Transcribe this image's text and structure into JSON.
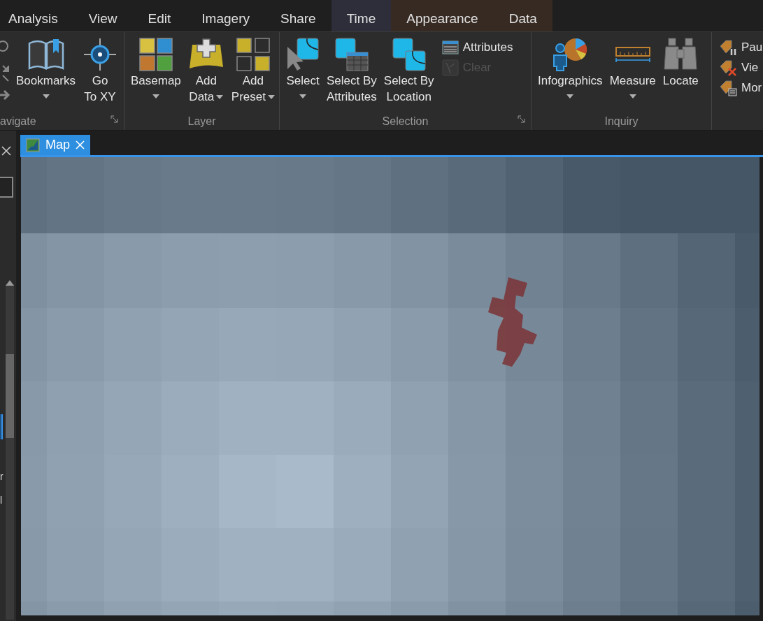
{
  "menu_tabs": [
    {
      "label": "Analysis",
      "selected": false
    },
    {
      "label": "View",
      "selected": false
    },
    {
      "label": "Edit",
      "selected": false
    },
    {
      "label": "Imagery",
      "selected": false
    },
    {
      "label": "Share",
      "selected": false
    },
    {
      "label": "Time",
      "selected": false,
      "color": "#2d2e3a"
    },
    {
      "label": "Appearance",
      "selected": false,
      "color": "#362a23"
    },
    {
      "label": "Data",
      "selected": false,
      "color": "#362a23"
    }
  ],
  "ribbon": {
    "groups": [
      {
        "label": "avigate",
        "launcher": true,
        "buttons": [
          {
            "kind": "large",
            "lines": [
              "Bookmarks"
            ],
            "dropdown": true,
            "disabled": false
          },
          {
            "kind": "large",
            "lines": [
              "Go",
              "To XY"
            ],
            "dropdown": false,
            "disabled": false
          }
        ]
      },
      {
        "label": "Layer",
        "buttons": [
          {
            "kind": "large",
            "lines": [
              "Basemap"
            ],
            "dropdown": true,
            "disabled": false
          },
          {
            "kind": "large",
            "lines": [
              "Add",
              "Data"
            ],
            "dropdown": true,
            "disabled": false
          },
          {
            "kind": "large",
            "lines": [
              "Add",
              "Preset"
            ],
            "dropdown": true,
            "disabled": false
          }
        ]
      },
      {
        "label": "Selection",
        "launcher": true,
        "buttons": [
          {
            "kind": "large",
            "lines": [
              "Select"
            ],
            "dropdown": true,
            "disabled": false
          },
          {
            "kind": "large",
            "lines": [
              "Select By",
              "Attributes"
            ],
            "dropdown": false,
            "disabled": false
          },
          {
            "kind": "large",
            "lines": [
              "Select By",
              "Location"
            ],
            "dropdown": false,
            "disabled": false
          },
          {
            "kind": "small",
            "lines": [
              "Attributes"
            ],
            "disabled": false
          },
          {
            "kind": "small",
            "lines": [
              "Clear"
            ],
            "disabled": true
          }
        ]
      },
      {
        "label": "Inquiry",
        "buttons": [
          {
            "kind": "large",
            "lines": [
              "Infographics"
            ],
            "dropdown": true,
            "disabled": false
          },
          {
            "kind": "large",
            "lines": [
              "Measure"
            ],
            "dropdown": true,
            "disabled": false
          },
          {
            "kind": "large",
            "lines": [
              "Locate"
            ],
            "dropdown": false,
            "disabled": false
          }
        ]
      },
      {
        "buttons": [
          {
            "kind": "small",
            "lines": [
              "Pau"
            ],
            "disabled": false
          },
          {
            "kind": "small",
            "lines": [
              "Vie"
            ],
            "disabled": false
          },
          {
            "kind": "small",
            "lines": [
              "Mor"
            ],
            "disabled": false
          }
        ]
      }
    ]
  },
  "side_panel": {
    "items": [
      {
        "label": "r"
      },
      {
        "label": "l"
      }
    ]
  },
  "document_tabs": [
    {
      "label": "Map",
      "selected": true
    }
  ]
}
